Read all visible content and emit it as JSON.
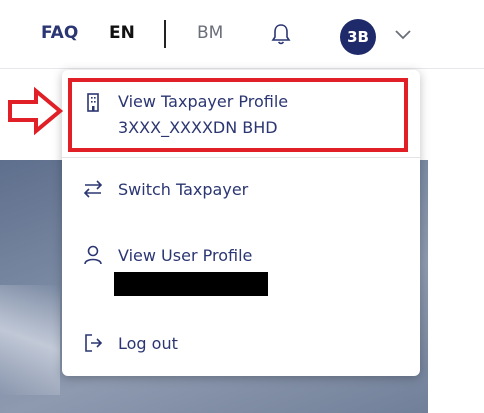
{
  "header": {
    "faq_label": "FAQ",
    "lang_en": "EN",
    "lang_bm": "BM",
    "avatar_initials": "3B"
  },
  "menu": {
    "view_taxpayer_profile": "View Taxpayer Profile",
    "taxpayer_name": "3XXX_XXXXDN BHD",
    "switch_taxpayer": "Switch Taxpayer",
    "view_user_profile": "View User Profile",
    "logout": "Log out"
  },
  "colors": {
    "brand": "#1f2a6b",
    "link": "#2b3672",
    "highlight": "#e01f26"
  },
  "icons": {
    "bell": "bell-icon",
    "chevron": "chevron-down-icon",
    "building": "building-icon",
    "switch": "switch-arrows-icon",
    "user": "user-icon",
    "logout": "logout-icon",
    "arrow": "arrow-right-icon"
  }
}
